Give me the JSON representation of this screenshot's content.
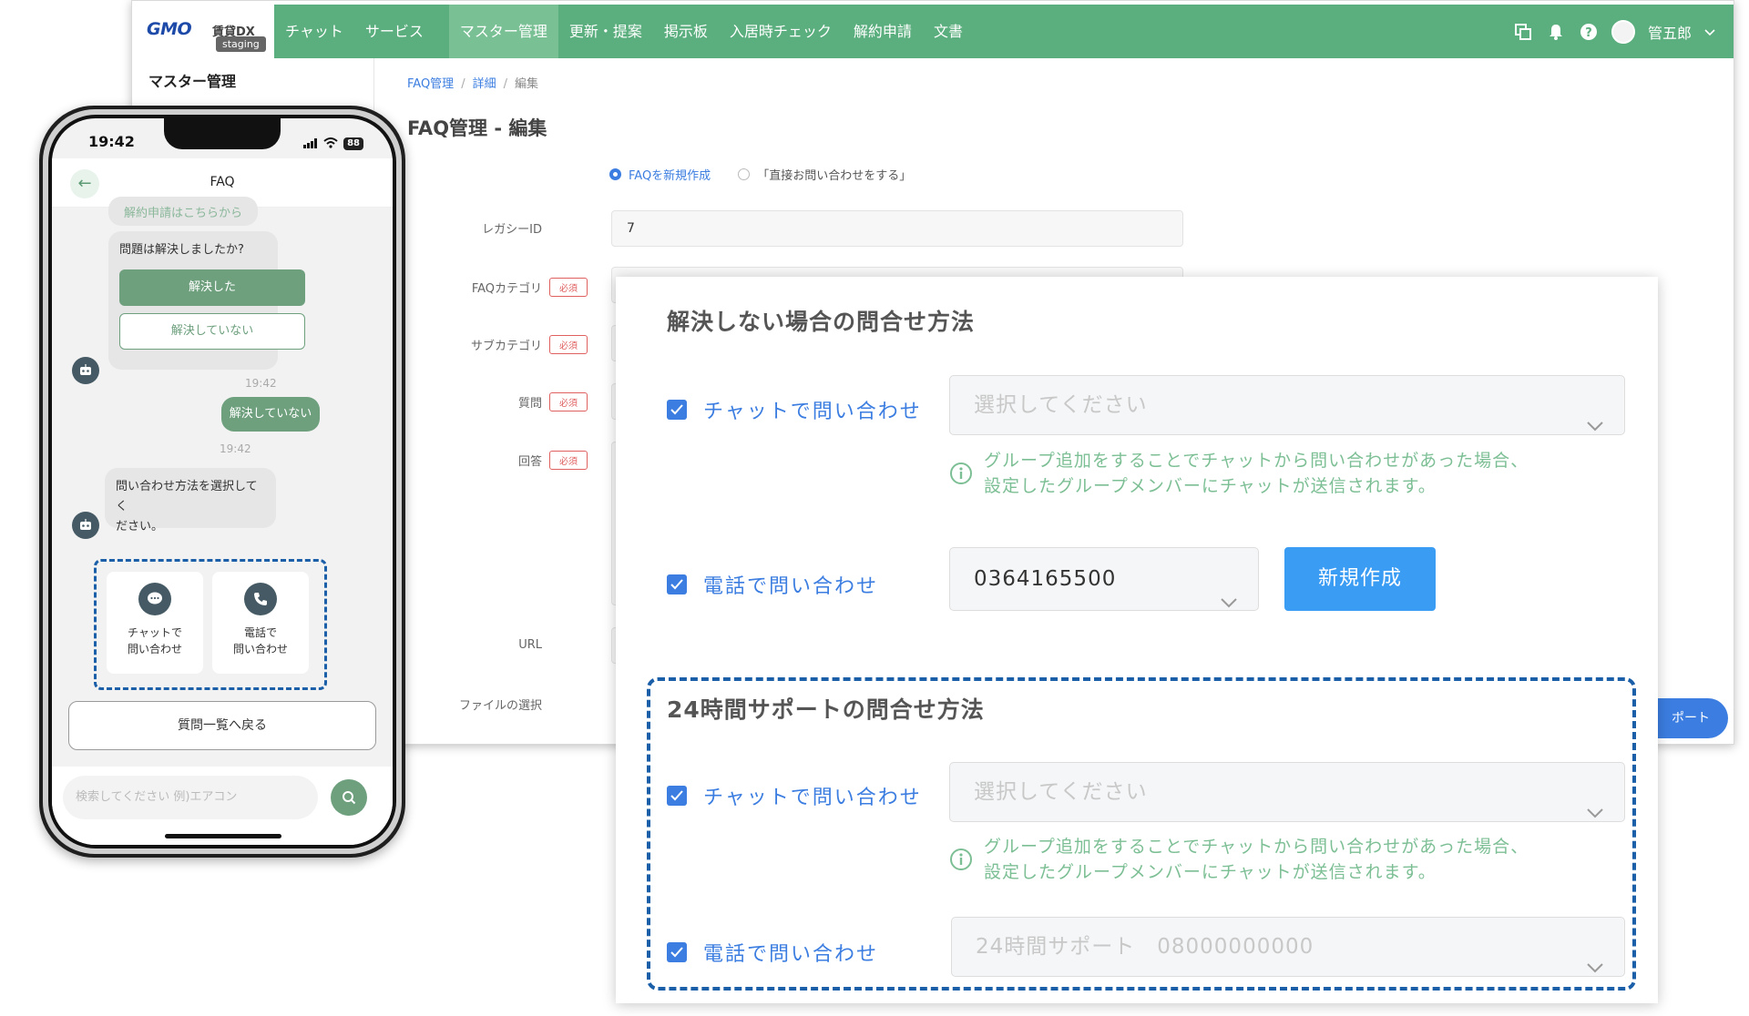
{
  "header": {
    "logo": "GMO",
    "logo_sub": "賃貸DX",
    "env_badge": "staging",
    "nav": [
      "チャット",
      "サービス",
      "マスター管理",
      "更新・提案",
      "掲示板",
      "入居時チェック",
      "解約申請",
      "文書"
    ],
    "active_nav": "マスター管理",
    "user_name": "管五郎",
    "icons": [
      "windows-icon",
      "bell-icon",
      "help-icon",
      "avatar"
    ]
  },
  "sidebar": {
    "title": "マスター管理"
  },
  "breadcrumb": [
    "FAQ管理",
    "詳細",
    "編集"
  ],
  "page_title": "FAQ管理 - 編集",
  "radio": {
    "option_new": "FAQを新規作成",
    "option_direct": "「直接お問い合わせをする」",
    "selected": "FAQを新規作成"
  },
  "form": {
    "legacy_id_label": "レガシーID",
    "legacy_id_value": "7",
    "category_label": "FAQカテゴリ",
    "subcategory_label": "サブカテゴリ",
    "question_label": "質問",
    "answer_label": "回答",
    "url_label": "URL",
    "file_label": "ファイルの選択",
    "required_badge": "必須",
    "support_button_partial": "ポート"
  },
  "overlay": {
    "section1_title": "解決しない場合の問合せ方法",
    "section2_title": "24時間サポートの問合せ方法",
    "chat_label": "チャットで問い合わせ",
    "phone_label": "電話で問い合わせ",
    "select_placeholder": "選択してください",
    "info_line1": "グループ追加をすることでチャットから問い合わせがあった場合、",
    "info_line2": "設定したグループメンバーにチャットが送信されます。",
    "phone_value": "0364165500",
    "new_button": "新規作成",
    "support_phone_value": "24時間サポート　08000000000"
  },
  "phone": {
    "status_time": "19:42",
    "battery": "88",
    "title": "FAQ",
    "chip_top": "解約申請はこちらから",
    "question_bubble": "問題は解決しましたか?",
    "btn_resolved": "解決した",
    "btn_unresolved": "解決していない",
    "time1": "19:42",
    "my_message": "解決していない",
    "time2": "19:42",
    "bot_message_line1": "問い合わせ方法を選択してく",
    "bot_message_line2": "ださい。",
    "opt_chat_line1": "チャットで",
    "opt_chat_line2": "問い合わせ",
    "opt_phone_line1": "電話で",
    "opt_phone_line2": "問い合わせ",
    "back_to_list": "質問一覧へ戻る",
    "search_placeholder": "検索してください 例)エアコン"
  },
  "colors": {
    "header_green": "#5bae7d",
    "active_nav": "#79c094",
    "accent_blue": "#3b7de0",
    "chat_green": "#6ea07e",
    "dashed_outline": "#1b5fa8"
  }
}
